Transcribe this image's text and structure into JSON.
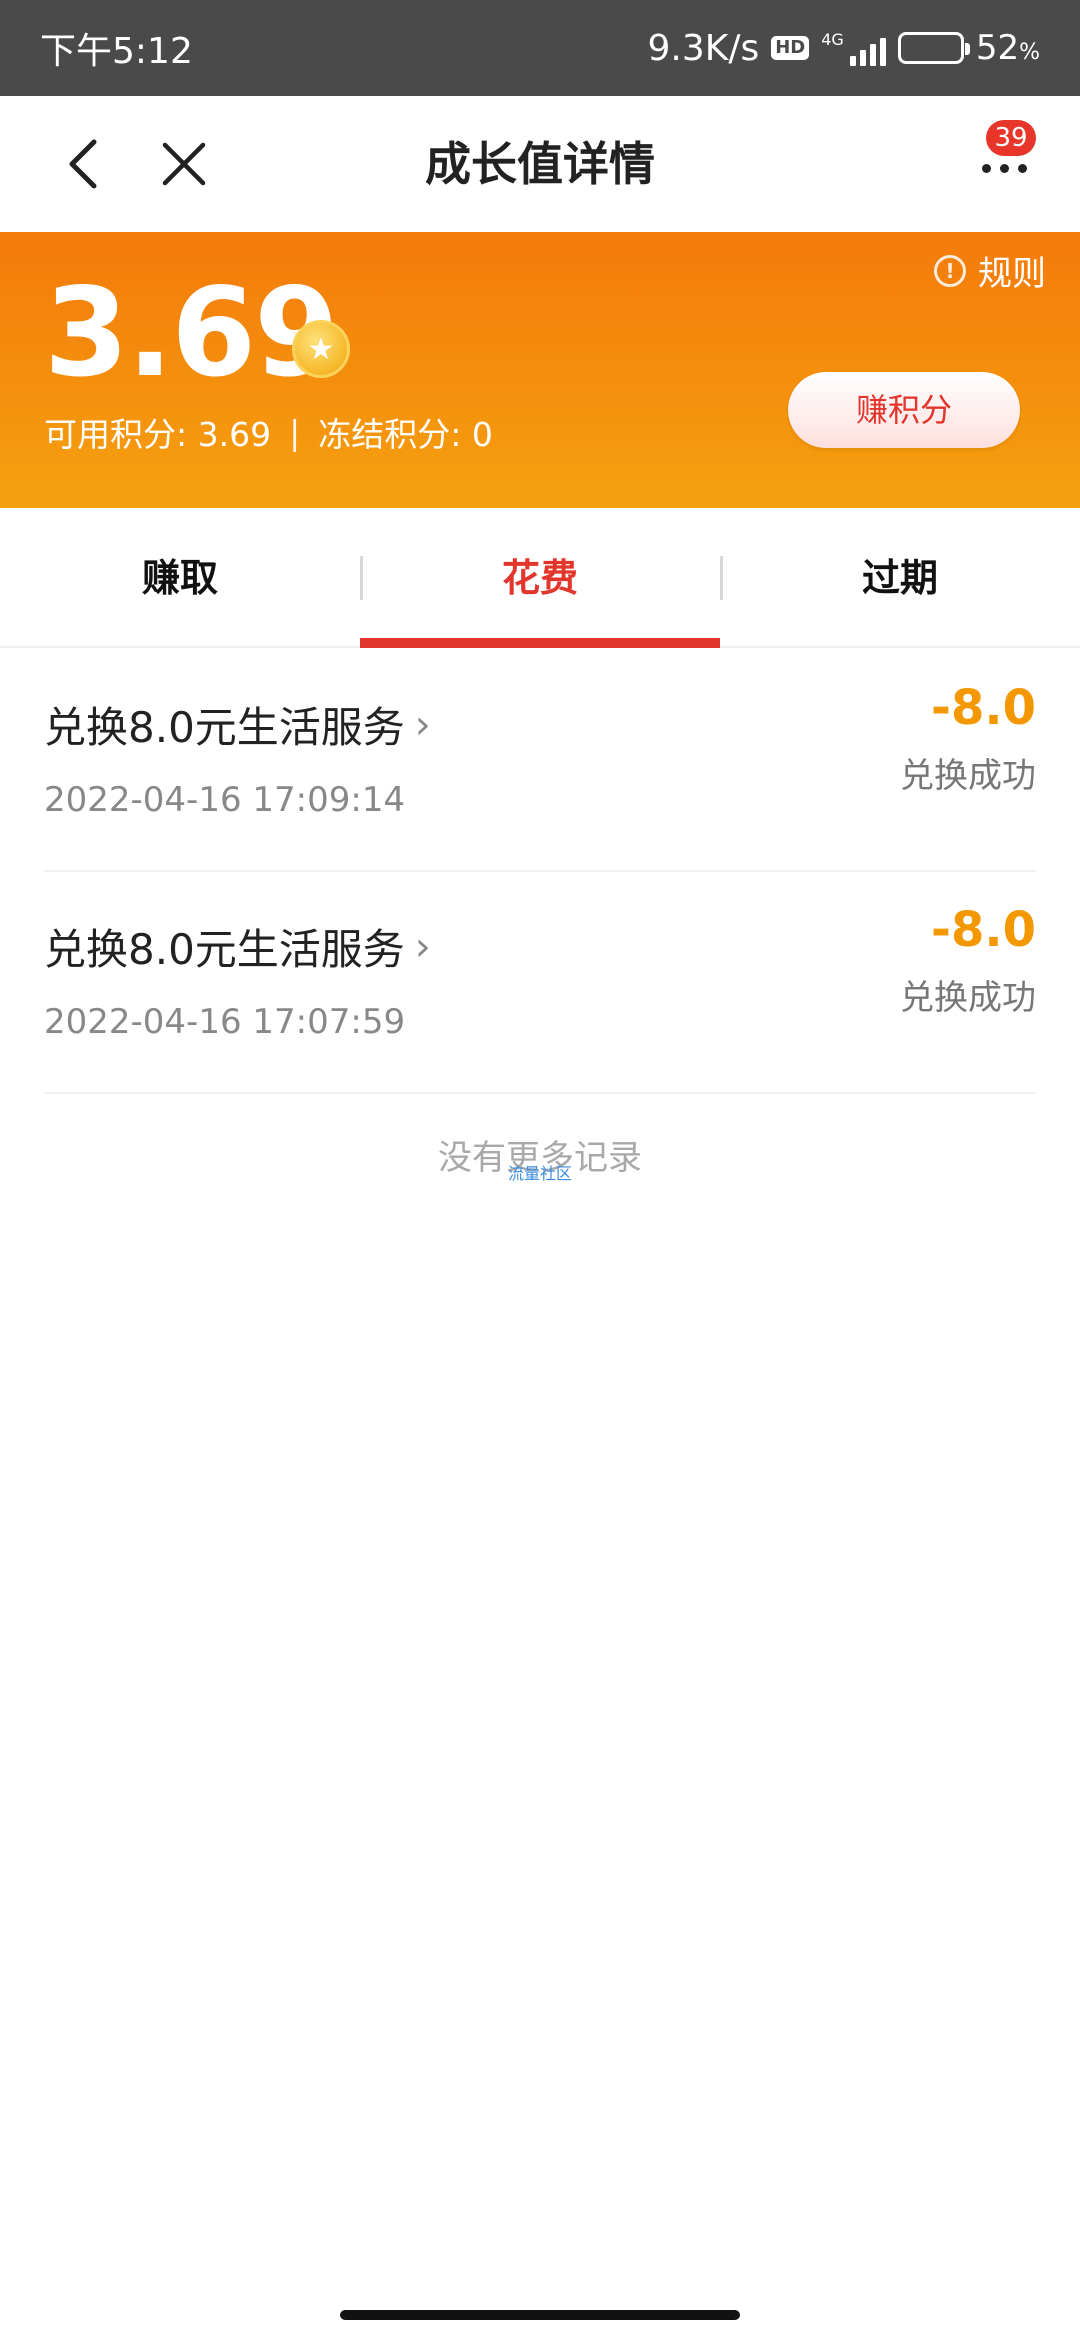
{
  "status_bar": {
    "time": "下午5:12",
    "net_speed": "9.3K/s",
    "hd": "HD",
    "network": "4G",
    "battery_level": 0.52,
    "battery_pct": "52",
    "pct_sign": "%"
  },
  "header": {
    "title": "成长值详情",
    "badge_count": "39"
  },
  "hero": {
    "rules_label": "规则",
    "score": "3.69",
    "available_label": "可用积分: 3.69",
    "separator": "|",
    "frozen_label": "冻结积分: 0",
    "earn_button": "赚积分",
    "colors": {
      "gradient_top": "#f47a0c",
      "gradient_bottom": "#f5a10e"
    }
  },
  "tabs": [
    {
      "label": "赚取",
      "active": false
    },
    {
      "label": "花费",
      "active": true
    },
    {
      "label": "过期",
      "active": false
    }
  ],
  "records": [
    {
      "title": "兑换8.0元生活服务",
      "time": "2022-04-16 17:09:14",
      "amount": "-8.0",
      "status": "兑换成功"
    },
    {
      "title": "兑换8.0元生活服务",
      "time": "2022-04-16 17:07:59",
      "amount": "-8.0",
      "status": "兑换成功"
    }
  ],
  "footer_text": "没有更多记录",
  "watermark": "流量社区",
  "colors": {
    "accent_red": "#e2352b",
    "amount_orange": "#f39800"
  }
}
